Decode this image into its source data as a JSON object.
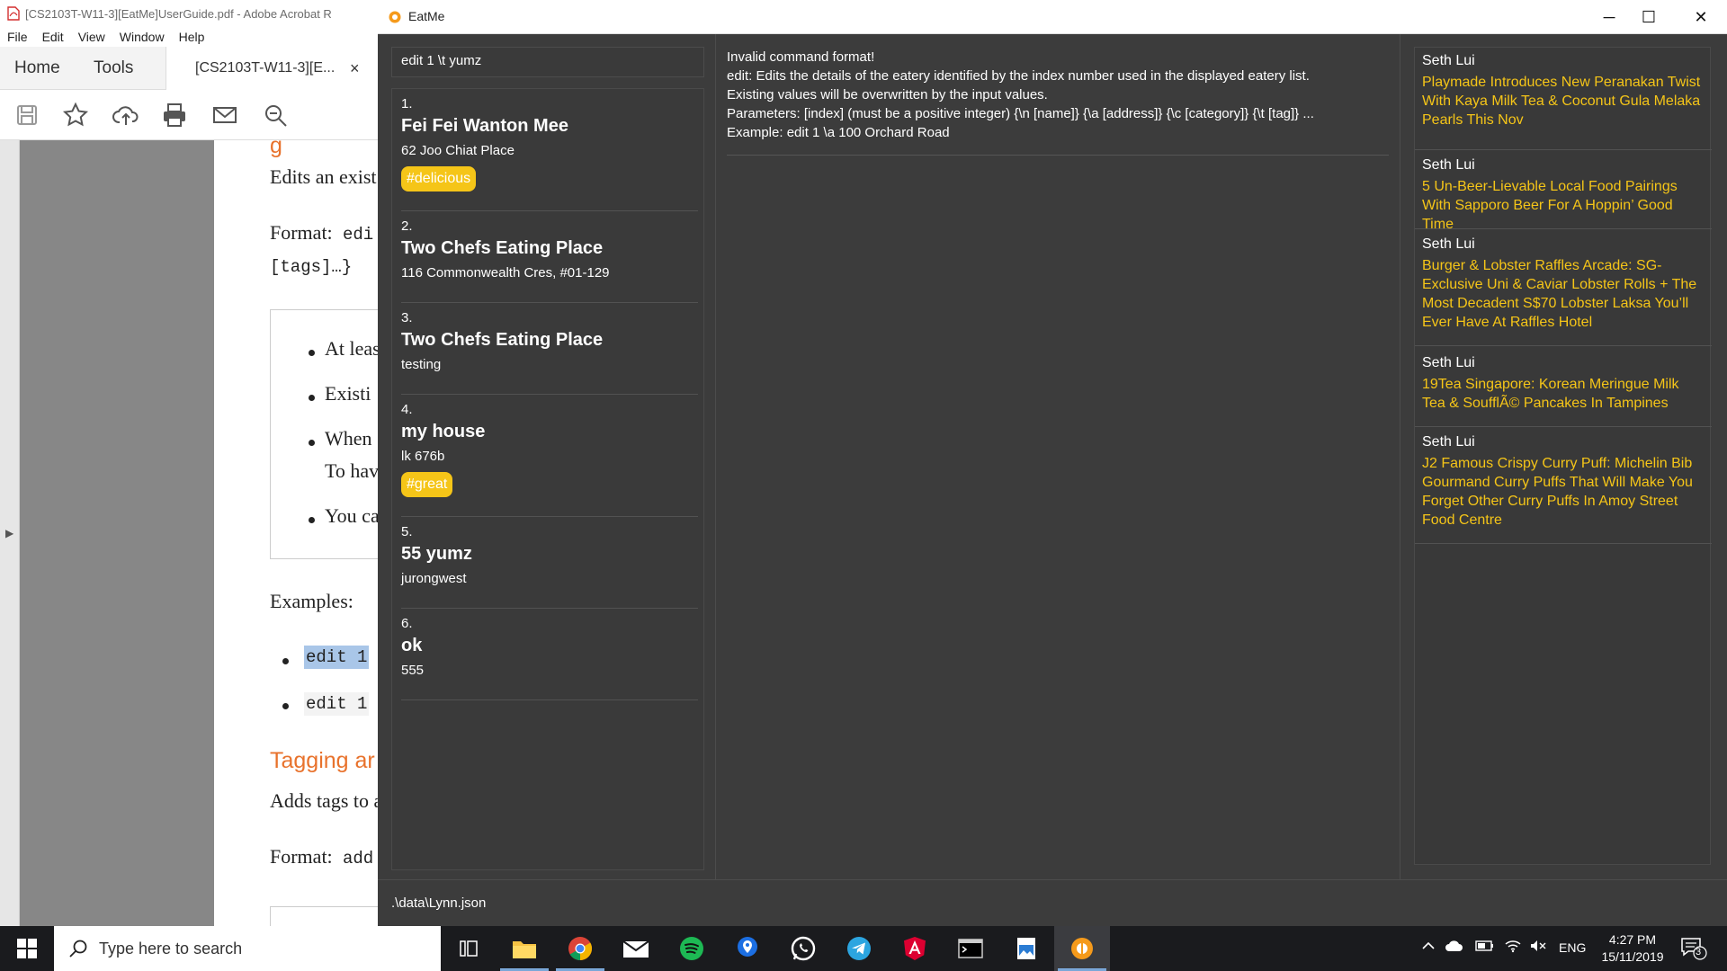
{
  "acrobat": {
    "window_title": "[CS2103T-W11-3][EatMe]UserGuide.pdf - Adobe Acrobat R",
    "menu": [
      "File",
      "Edit",
      "View",
      "Window",
      "Help"
    ],
    "tabs": {
      "home": "Home",
      "tools": "Tools",
      "document": "[CS2103T-W11-3][E...",
      "close": "×"
    },
    "page": {
      "heading_fragment": "g",
      "line1": "Edits an exist",
      "format_label": "Format:",
      "format_code": "edi",
      "format_code2": "[tags]…}",
      "bullets": [
        "At leas",
        "Existi",
        "When",
        "To hav",
        "You ca"
      ],
      "examples_label": "Examples:",
      "example1": "edit 1",
      "example2": "edit 1",
      "section_heading": "Tagging ar",
      "section_line": "Adds tags to a",
      "format2_label": "Format:",
      "format2_code": "add"
    }
  },
  "eatme": {
    "window_title": "EatMe",
    "controls": {
      "minimize": "─",
      "maximize": "☐",
      "close": "✕"
    },
    "command_input": "edit 1 \\t yumz",
    "eateries": [
      {
        "index": "1.",
        "name": "Fei Fei Wanton Mee",
        "address": "62 Joo Chiat Place",
        "tags": [
          "#delicious"
        ]
      },
      {
        "index": "2.",
        "name": "Two Chefs Eating Place",
        "address": "116 Commonwealth Cres, #01-129",
        "tags": []
      },
      {
        "index": "3.",
        "name": "Two Chefs Eating Place",
        "address": "testing",
        "tags": []
      },
      {
        "index": "4.",
        "name": "my house",
        "address": "lk 676b",
        "tags": [
          "#great"
        ]
      },
      {
        "index": "5.",
        "name": "55 yumz",
        "address": "jurongwest",
        "tags": []
      },
      {
        "index": "6.",
        "name": "ok",
        "address": "555",
        "tags": []
      }
    ],
    "result": [
      "Invalid command format!",
      "edit: Edits the details of the eatery identified by the index number used in the displayed eatery list.",
      "Existing values will be overwritten by the input values.",
      "Parameters: [index] (must be a positive integer) {\\n [name]} {\\a [address]} {\\c [category]} {\\t [tag]} ...",
      "Example: edit 1 \\a 100 Orchard Road"
    ],
    "feeds": [
      {
        "author": "Seth Lui",
        "headline": "Playmade Introduces New Peranakan Twist With Kaya Milk Tea & Coconut Gula Melaka Pearls This Nov"
      },
      {
        "author": "Seth Lui",
        "headline": "5 Un-Beer-Lievable Local Food Pairings With Sapporo Beer For A Hoppin’ Good Time"
      },
      {
        "author": "Seth Lui",
        "headline": "Burger & Lobster Raffles Arcade: SG-Exclusive Uni & Caviar Lobster Rolls + The Most Decadent S$70 Lobster Laksa You’ll Ever Have At Raffles Hotel"
      },
      {
        "author": "Seth Lui",
        "headline": "19Tea Singapore: Korean Meringue Milk Tea & SoufflÃ© Pancakes In Tampines"
      },
      {
        "author": "Seth Lui",
        "headline": "J2 Famous Crispy Curry Puff: Michelin Bib Gourmand Curry Puffs That Will Make You Forget Other Curry Puffs In Amoy Street Food Centre"
      }
    ],
    "status_path": ".\\data\\Lynn.json",
    "colors": {
      "background": "#3c3c3c",
      "tag": "#f5c518",
      "feed_link": "#f5c518"
    }
  },
  "taskbar": {
    "search_placeholder": "Type here to search",
    "apps": [
      "task-view-icon",
      "file-explorer-icon",
      "chrome-icon",
      "mail-icon",
      "spotify-icon",
      "maps-icon",
      "whatsapp-icon",
      "telegram-icon",
      "angular-icon",
      "terminal-icon",
      "photos-icon",
      "eatme-icon"
    ],
    "language": "ENG",
    "time": "4:27 PM",
    "date": "15/11/2019",
    "notification_count": "3"
  }
}
